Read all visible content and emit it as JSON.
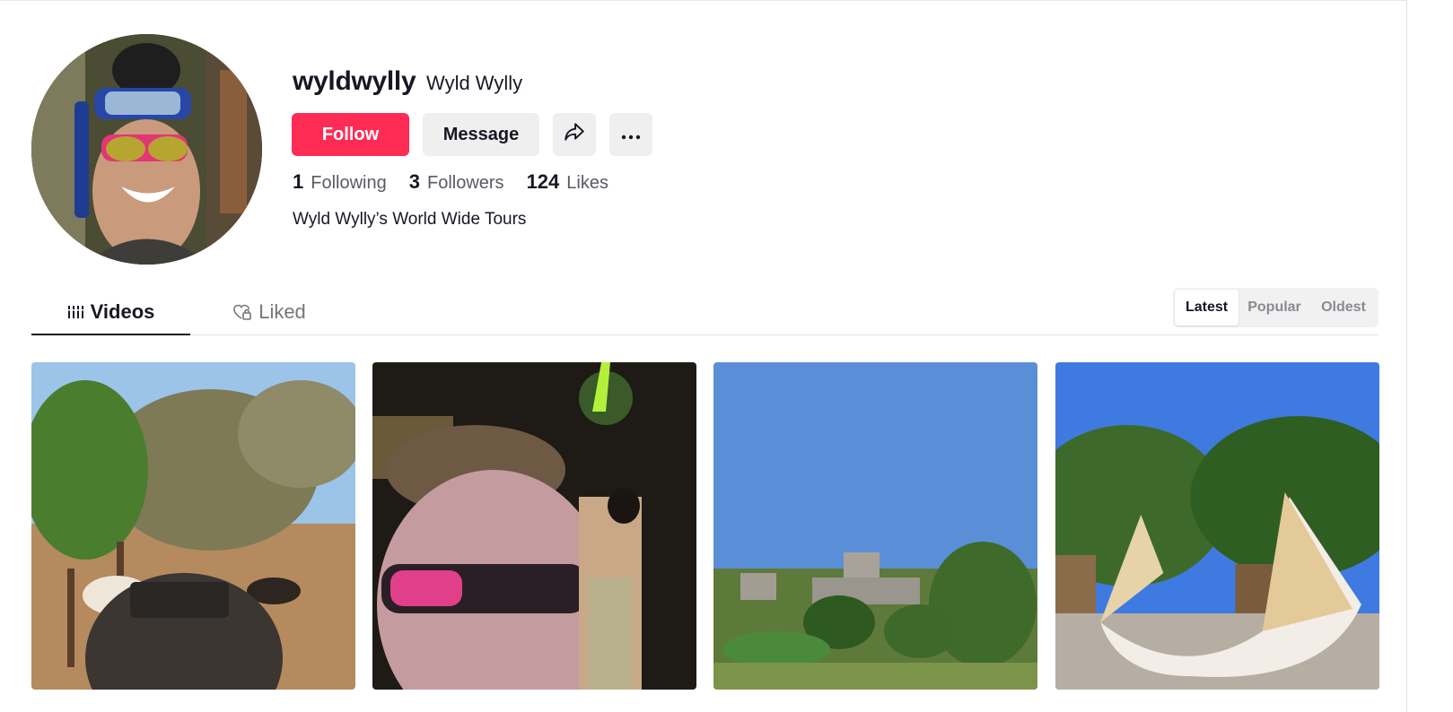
{
  "profile": {
    "username": "wyldwylly",
    "nickname": "Wyld Wylly",
    "bio": "Wyld Wylly’s World Wide Tours"
  },
  "actions": {
    "follow_label": "Follow",
    "message_label": "Message",
    "share_icon": "share-arrow-icon",
    "more_icon": "more-horizontal-icon"
  },
  "stats": [
    {
      "count": "1",
      "label": "Following"
    },
    {
      "count": "3",
      "label": "Followers"
    },
    {
      "count": "124",
      "label": "Likes"
    }
  ],
  "tabs": [
    {
      "label": "Videos",
      "icon": "grid-lines-icon",
      "active": true
    },
    {
      "label": "Liked",
      "icon": "heart-lock-icon",
      "active": false
    }
  ],
  "sort": {
    "options": [
      "Latest",
      "Popular",
      "Oldest"
    ],
    "selected": "Latest"
  },
  "colors": {
    "accent": "#fe2c55",
    "text": "#161823",
    "muted": "#757679"
  },
  "videos": [
    {
      "description": "selfie with cap in front of horses and trees"
    },
    {
      "description": "night selfie with sunglasses at party"
    },
    {
      "description": "ancient ruins under blue sky"
    },
    {
      "description": "white sculpture in plaza with trees"
    }
  ]
}
